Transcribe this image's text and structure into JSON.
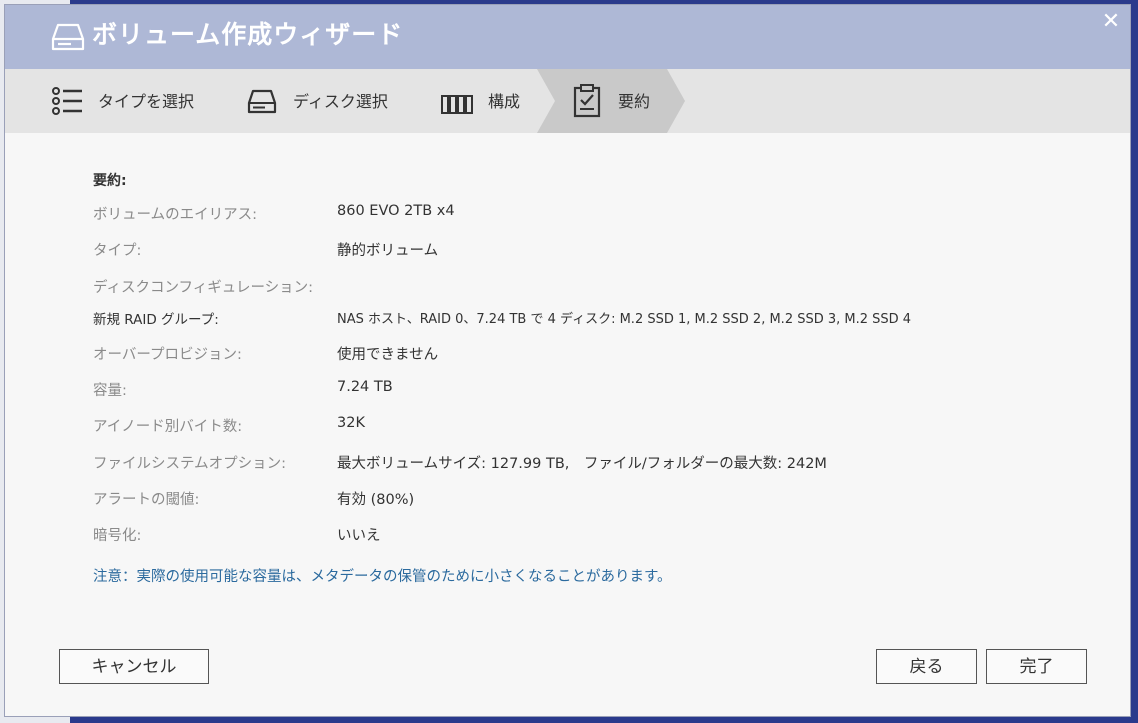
{
  "dialog": {
    "title": "ボリューム作成ウィザード",
    "close": "✕"
  },
  "steps": [
    {
      "label": "タイプを選択",
      "icon": "list-icon"
    },
    {
      "label": "ディスク選択",
      "icon": "disk-icon"
    },
    {
      "label": "構成",
      "icon": "raid-config-icon"
    },
    {
      "label": "要約",
      "icon": "clipboard-check-icon"
    }
  ],
  "active_step": "要約",
  "summary": {
    "heading": "要約:",
    "rows": [
      {
        "key": "ボリュームのエイリアス:",
        "value": "860 EVO 2TB x4"
      },
      {
        "key": "タイプ:",
        "value": "静的ボリューム"
      },
      {
        "key": "ディスクコンフィギュレーション:",
        "value": ""
      },
      {
        "key": "新規 RAID グループ:",
        "value": "NAS ホスト、RAID 0、7.24 TB で 4 ディスク: M.2 SSD 1,  M.2 SSD 2,  M.2 SSD 3,  M.2 SSD 4"
      },
      {
        "key": "オーバープロビジョン:",
        "value": "使用できません"
      },
      {
        "key": "容量:",
        "value": "7.24 TB"
      },
      {
        "key": "アイノード別バイト数:",
        "value": "32K"
      },
      {
        "key": "ファイルシステムオプション:",
        "value": "最大ボリュームサイズ: 127.99 TB,　ファイル/フォルダーの最大数: 242M"
      },
      {
        "key": "アラートの閾値:",
        "value": "有効 (80%)"
      },
      {
        "key": "暗号化:",
        "value": "いいえ"
      }
    ],
    "note": "注意：実際の使用可能な容量は、メタデータの保管のために小さくなることがあります。"
  },
  "buttons": {
    "cancel": "キャンセル",
    "back": "戻る",
    "finish": "完了"
  },
  "colors": {
    "titlebar": "#aeb8d6",
    "stepbar": "#e4e4e4",
    "active_step": "#c9c9c9",
    "note": "#2b6a9e",
    "desktop": "#2a3a8c"
  }
}
